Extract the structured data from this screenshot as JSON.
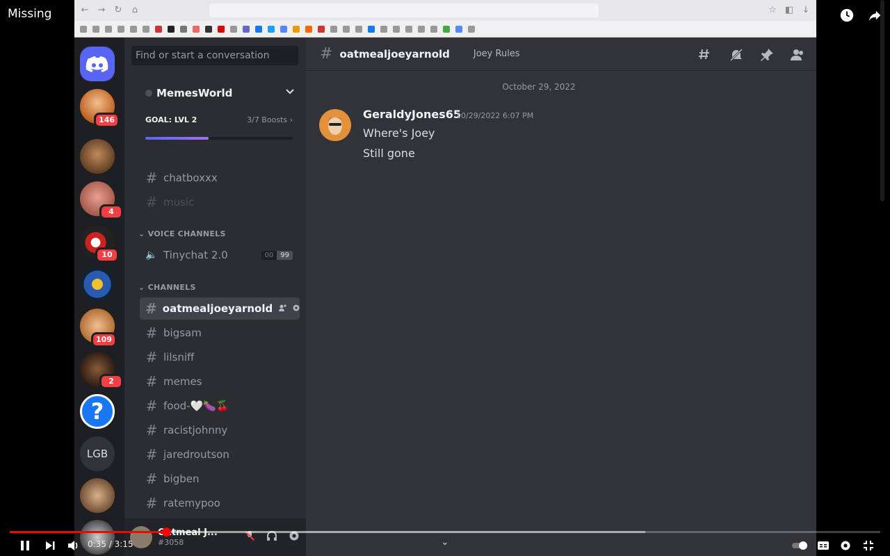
{
  "video": {
    "title": "Missing",
    "current_time": "0:35",
    "duration": "3:15",
    "played_fraction": 0.18,
    "buffered_fraction": 0.73
  },
  "discord": {
    "search_placeholder": "Find or start a conversation",
    "server": {
      "name": "MemesWorld",
      "boost_goal": "GOAL: LVL 2",
      "boosts": "3/7 Boosts",
      "boost_progress": 0.43
    },
    "top_channels": [
      "chatboxxx",
      "music"
    ],
    "voice_category": "VOICE CHANNELS",
    "voice_channel": {
      "name": "Tinychat 2.0",
      "count_a": "00",
      "count_b": "99"
    },
    "text_category": "CHANNELS",
    "channels": [
      "oatmealjoeyarnold",
      "bigsam",
      "lilsniff",
      "memes",
      "food-🤍🍆🍒",
      "racistjohnny",
      "jaredroutson",
      "bigben",
      "ratemypoo"
    ],
    "selected_channel": "oatmealjoeyarnold",
    "channel_topic": "Joey Rules",
    "server_badges": [
      "146",
      "4",
      "10",
      "109",
      "2"
    ],
    "server_initials": "LGB",
    "help_glyph": "?",
    "user": {
      "name": "Oatmeal J...",
      "tag": "#3058"
    },
    "date_divider": "October 29, 2022",
    "message": {
      "author": "GeraldyJones65",
      "timestamp": "10/29/2022 6:07 PM",
      "lines": [
        "Where's Joey",
        "Still gone"
      ]
    }
  },
  "colors": {
    "accent": "#5865f2",
    "badge": "#f23f43",
    "progress": "#ff0000"
  }
}
